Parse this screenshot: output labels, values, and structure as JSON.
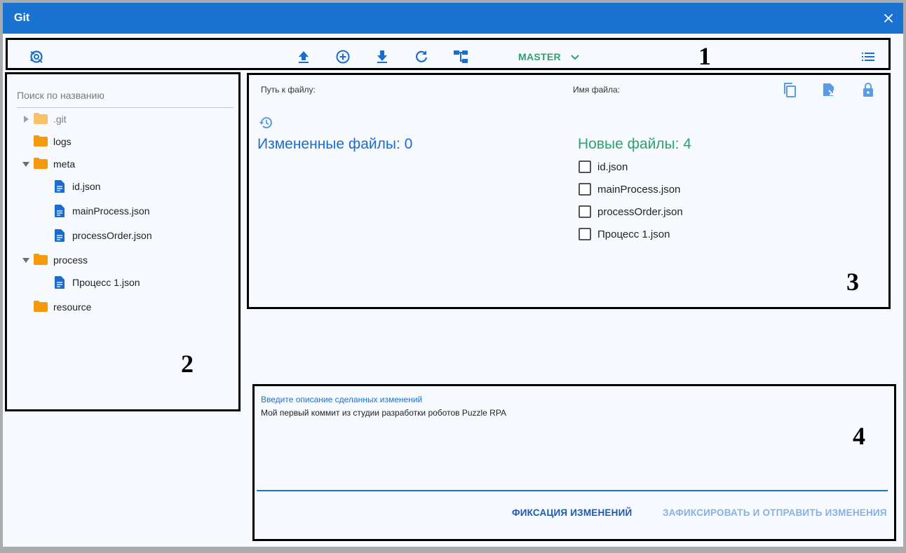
{
  "window": {
    "title": "Git"
  },
  "toolbar": {
    "branch": "MASTER",
    "icons": [
      "git-logo-icon",
      "push-icon",
      "add-icon",
      "pull-icon",
      "refresh-icon",
      "branches-icon",
      "list-icon"
    ]
  },
  "tree": {
    "search_placeholder": "Поиск по названию",
    "items": [
      {
        "label": ".git",
        "type": "folder"
      },
      {
        "label": "logs",
        "type": "folder"
      },
      {
        "label": "meta",
        "type": "folder"
      },
      {
        "label": "id.json",
        "type": "file"
      },
      {
        "label": "mainProcess.json",
        "type": "file"
      },
      {
        "label": "processOrder.json",
        "type": "file"
      },
      {
        "label": "process",
        "type": "folder"
      },
      {
        "label": "Процесс 1.json",
        "type": "file"
      },
      {
        "label": "resource",
        "type": "folder"
      }
    ]
  },
  "details": {
    "path_label": "Путь к файлу:",
    "name_label": "Имя файла:",
    "changed_title": "Измененные файлы: 0",
    "new_title": "Новые файлы: 4",
    "new_files": [
      "id.json",
      "mainProcess.json",
      "processOrder.json",
      "Процесс 1.json"
    ]
  },
  "commit": {
    "label": "Введите описание сделанных изменений",
    "message": "Мой первый коммит из студии разработки роботов Puzzle RPA",
    "commit_button": "ФИКСАЦИЯ ИЗМЕНЕНИЙ",
    "commit_push_button": "ЗАФИКСИРОВАТЬ И ОТПРАВИТЬ ИЗМЕНЕНИЯ"
  },
  "callouts": [
    "1",
    "2",
    "3",
    "4"
  ],
  "colors": {
    "accent": "#1a73d1",
    "success": "#2da36b",
    "folder": "#f59a0c",
    "file": "#1a6ccf"
  }
}
